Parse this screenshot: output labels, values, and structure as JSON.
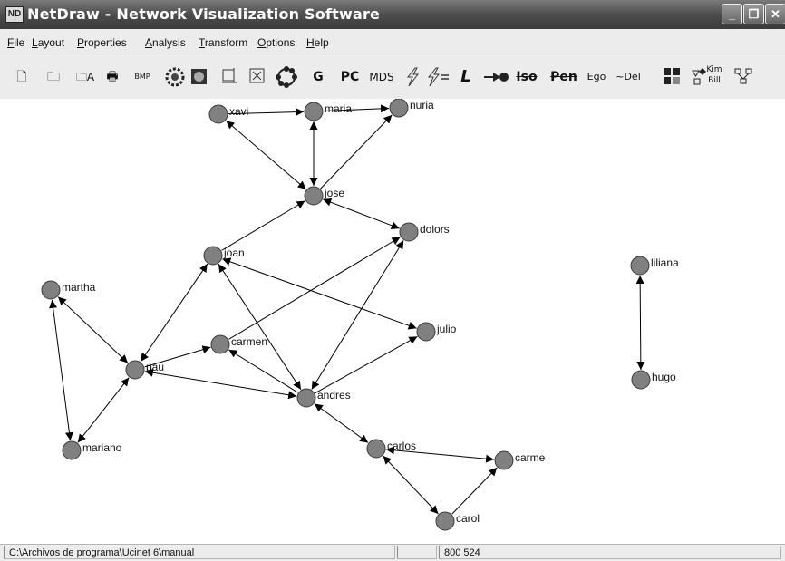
{
  "window": {
    "title": "NetDraw - Network Visualization Software",
    "icon_glyph": "ND",
    "controls": {
      "minimize": "_",
      "restore": "❐",
      "close": "✕"
    }
  },
  "menu": [
    "File",
    "Layout",
    "Properties",
    "Analysis",
    "Transform",
    "Options",
    "Help"
  ],
  "toolbar": {
    "new_icon": "🗋",
    "open_icon": "🗀",
    "open_attr_icon": "🗀A",
    "print_icon": "🖶",
    "bmp_icon": "BMP",
    "g": "G",
    "pc": "PC",
    "mds": "MDS",
    "l": "L",
    "iso": "Iso",
    "pen": "Pen",
    "ego": "Ego",
    "del": "~Del",
    "kim": "Kim",
    "bill": "Bill"
  },
  "graph": {
    "colors": {
      "node_fill": "#808080",
      "node_stroke": "#3a3a3a",
      "edge": "#000000"
    },
    "nodes": [
      {
        "id": "xavi",
        "label": "xavi"
      },
      {
        "id": "maria",
        "label": "maria"
      },
      {
        "id": "nuria",
        "label": "nuria"
      },
      {
        "id": "jose",
        "label": "jose"
      },
      {
        "id": "dolors",
        "label": "dolors"
      },
      {
        "id": "joan",
        "label": "joan"
      },
      {
        "id": "martha",
        "label": "martha"
      },
      {
        "id": "liliana",
        "label": "liliana"
      },
      {
        "id": "julio",
        "label": "julio"
      },
      {
        "id": "carmen",
        "label": "carmen"
      },
      {
        "id": "pau",
        "label": "pau"
      },
      {
        "id": "andres",
        "label": "andres"
      },
      {
        "id": "hugo",
        "label": "hugo"
      },
      {
        "id": "mariano",
        "label": "mariano"
      },
      {
        "id": "carlos",
        "label": "carlos"
      },
      {
        "id": "carme",
        "label": "carme"
      },
      {
        "id": "carol",
        "label": "carol"
      }
    ],
    "edges": [
      {
        "from": "xavi",
        "to": "maria",
        "dir": "forward"
      },
      {
        "from": "maria",
        "to": "nuria",
        "dir": "forward"
      },
      {
        "from": "xavi",
        "to": "jose",
        "dir": "both"
      },
      {
        "from": "maria",
        "to": "jose",
        "dir": "both"
      },
      {
        "from": "jose",
        "to": "nuria",
        "dir": "forward"
      },
      {
        "from": "jose",
        "to": "dolors",
        "dir": "both"
      },
      {
        "from": "joan",
        "to": "jose",
        "dir": "forward"
      },
      {
        "from": "joan",
        "to": "julio",
        "dir": "both"
      },
      {
        "from": "joan",
        "to": "pau",
        "dir": "both"
      },
      {
        "from": "joan",
        "to": "andres",
        "dir": "both"
      },
      {
        "from": "carmen",
        "to": "dolors",
        "dir": "forward"
      },
      {
        "from": "dolors",
        "to": "andres",
        "dir": "both"
      },
      {
        "from": "andres",
        "to": "julio",
        "dir": "forward"
      },
      {
        "from": "pau",
        "to": "carmen",
        "dir": "forward"
      },
      {
        "from": "pau",
        "to": "andres",
        "dir": "both"
      },
      {
        "from": "andres",
        "to": "carmen",
        "dir": "forward"
      },
      {
        "from": "martha",
        "to": "pau",
        "dir": "both"
      },
      {
        "from": "martha",
        "to": "mariano",
        "dir": "both"
      },
      {
        "from": "pau",
        "to": "mariano",
        "dir": "both"
      },
      {
        "from": "andres",
        "to": "carlos",
        "dir": "both"
      },
      {
        "from": "carlos",
        "to": "carme",
        "dir": "both"
      },
      {
        "from": "carlos",
        "to": "carol",
        "dir": "both"
      },
      {
        "from": "carol",
        "to": "carme",
        "dir": "forward"
      },
      {
        "from": "liliana",
        "to": "hugo",
        "dir": "both"
      }
    ]
  },
  "status": {
    "path": "C:\\Archivos de programa\\Ucinet 6\\manual",
    "middle": "",
    "dims": "800 524"
  }
}
